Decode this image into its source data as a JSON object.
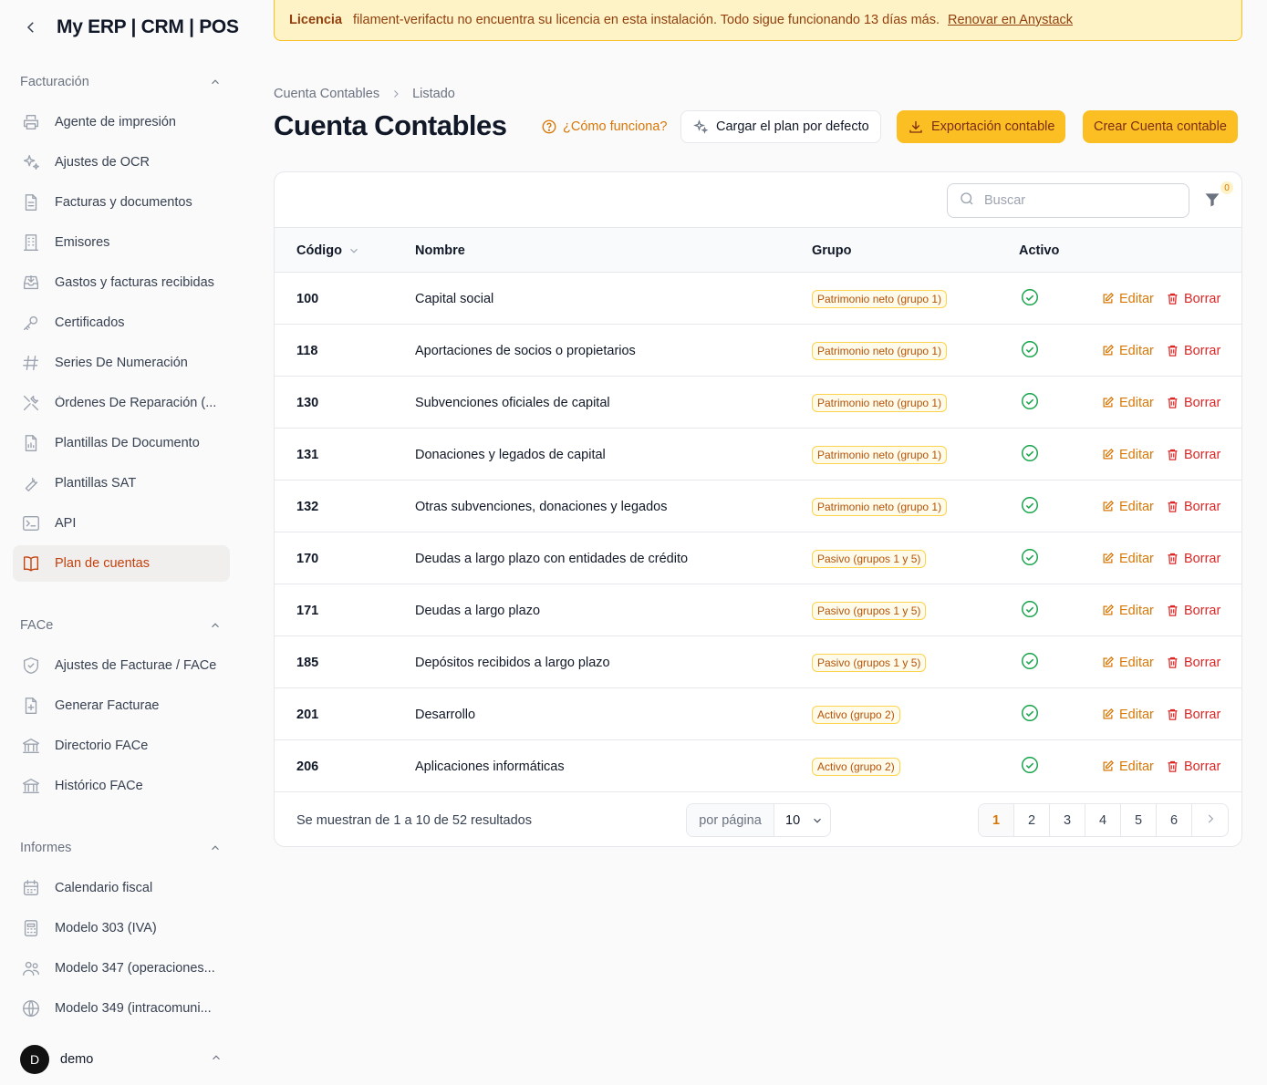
{
  "app": {
    "title": "My ERP | CRM | POS"
  },
  "banner": {
    "title": "Licencia",
    "message": "filament-verifactu no encuentra su licencia en esta instalación. Todo sigue funcionando 13 días más.",
    "link": "Renovar en Anystack"
  },
  "sidebar": {
    "groups": [
      {
        "label": "Facturación",
        "items": [
          {
            "label": "Agente de impresión",
            "icon": "printer-icon"
          },
          {
            "label": "Ajustes de OCR",
            "icon": "sparkles-icon"
          },
          {
            "label": "Facturas y documentos",
            "icon": "document-icon"
          },
          {
            "label": "Emisores",
            "icon": "building-icon"
          },
          {
            "label": "Gastos y facturas recibidas",
            "icon": "inbox-download-icon"
          },
          {
            "label": "Certificados",
            "icon": "key-icon"
          },
          {
            "label": "Series De Numeración",
            "icon": "hashtag-icon"
          },
          {
            "label": "Órdenes De Reparación (...",
            "icon": "tools-icon"
          },
          {
            "label": "Plantillas De Documento",
            "icon": "document-chart-icon"
          },
          {
            "label": "Plantillas SAT",
            "icon": "wrench-icon"
          },
          {
            "label": "API",
            "icon": "terminal-icon"
          },
          {
            "label": "Plan de cuentas",
            "icon": "book-open-icon"
          }
        ]
      },
      {
        "label": "FACe",
        "items": [
          {
            "label": "Ajustes de Facturae / FACe",
            "icon": "shield-check-icon"
          },
          {
            "label": "Generar Facturae",
            "icon": "document-plus-icon"
          },
          {
            "label": "Directorio FACe",
            "icon": "library-icon"
          },
          {
            "label": "Histórico FACe",
            "icon": "library-icon"
          }
        ]
      },
      {
        "label": "Informes",
        "items": [
          {
            "label": "Calendario fiscal",
            "icon": "calendar-icon"
          },
          {
            "label": "Modelo 303 (IVA)",
            "icon": "calculator-icon"
          },
          {
            "label": "Modelo 347 (operaciones...",
            "icon": "users-icon"
          },
          {
            "label": "Modelo 349 (intracomuni...",
            "icon": "globe-icon"
          }
        ]
      }
    ],
    "user": {
      "initial": "D",
      "name": "demo"
    }
  },
  "breadcrumb": [
    "Cuenta Contables",
    "Listado"
  ],
  "page": {
    "title": "Cuenta Contables"
  },
  "actions": {
    "help": "¿Cómo funciona?",
    "load_default": "Cargar el plan por defecto",
    "export": "Exportación contable",
    "create": "Crear Cuenta contable"
  },
  "table": {
    "search_placeholder": "Buscar",
    "filter_count": "0",
    "columns": {
      "code": "Código",
      "name": "Nombre",
      "group": "Grupo",
      "active": "Activo"
    },
    "edit_label": "Editar",
    "delete_label": "Borrar",
    "rows": [
      {
        "code": "100",
        "name": "Capital social",
        "group": "Patrimonio neto (grupo 1)",
        "active": true
      },
      {
        "code": "118",
        "name": "Aportaciones de socios o propietarios",
        "group": "Patrimonio neto (grupo 1)",
        "active": true
      },
      {
        "code": "130",
        "name": "Subvenciones oficiales de capital",
        "group": "Patrimonio neto (grupo 1)",
        "active": true
      },
      {
        "code": "131",
        "name": "Donaciones y legados de capital",
        "group": "Patrimonio neto (grupo 1)",
        "active": true
      },
      {
        "code": "132",
        "name": "Otras subvenciones, donaciones y legados",
        "group": "Patrimonio neto (grupo 1)",
        "active": true
      },
      {
        "code": "170",
        "name": "Deudas a largo plazo con entidades de crédito",
        "group": "Pasivo (grupos 1 y 5)",
        "active": true
      },
      {
        "code": "171",
        "name": "Deudas a largo plazo",
        "group": "Pasivo (grupos 1 y 5)",
        "active": true
      },
      {
        "code": "185",
        "name": "Depósitos recibidos a largo plazo",
        "group": "Pasivo (grupos 1 y 5)",
        "active": true
      },
      {
        "code": "201",
        "name": "Desarrollo",
        "group": "Activo (grupo 2)",
        "active": true
      },
      {
        "code": "206",
        "name": "Aplicaciones informáticas",
        "group": "Activo (grupo 2)",
        "active": true
      }
    ],
    "footer": {
      "summary": "Se muestran de 1 a 10 de 52 resultados",
      "per_page_label": "por página",
      "per_page_value": "10",
      "pages": [
        "1",
        "2",
        "3",
        "4",
        "5",
        "6"
      ],
      "current_page": "1"
    }
  },
  "colors": {
    "accent": "#d97706",
    "accent_bg": "#fbbf24",
    "danger": "#dc2626",
    "success": "#16a34a"
  }
}
